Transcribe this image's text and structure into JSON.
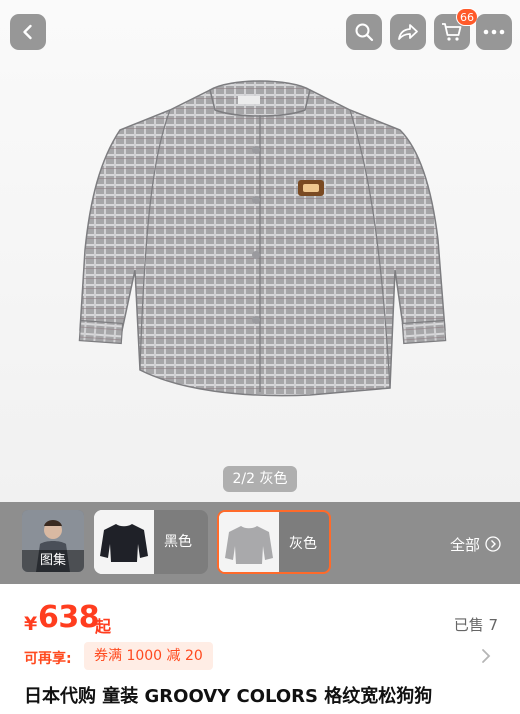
{
  "header": {
    "back_icon": "chevron-left-icon",
    "search_icon": "search-icon",
    "share_icon": "share-icon",
    "cart_icon": "cart-icon",
    "cart_count": "66",
    "more_icon": "more-icon"
  },
  "gallery": {
    "counter": "2/2 灰色"
  },
  "variants": {
    "gallery_label": "图集",
    "items": [
      {
        "label": "黑色"
      },
      {
        "label": "灰色"
      }
    ],
    "all_label": "全部",
    "accent": "#ff6a2a"
  },
  "product": {
    "price_symbol": "¥",
    "price": "638",
    "price_suffix": "起",
    "sold": "已售 7",
    "promo_label": "可再享:",
    "coupon": "券满 1000 减 20",
    "title": "日本代购 童装 GROOVY COLORS 格纹宽松狗狗"
  },
  "colors": {
    "price": "#ff3d1f",
    "badge": "#ff5a2a"
  }
}
